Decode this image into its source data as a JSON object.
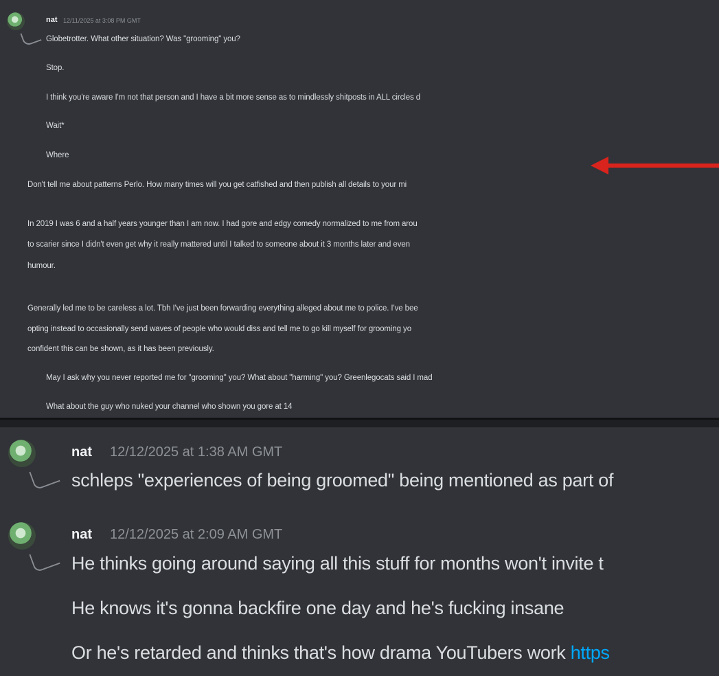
{
  "top_message": {
    "username": "nat",
    "timestamp": "12/11/2025 at 3:08 PM GMT",
    "lines": [
      "Globetrotter. What other situation? Was \"grooming\" you?",
      "Stop.",
      "I think you're aware I'm not that person and I have a bit more sense as to mindlessly shitposts in ALL circles d",
      "Wait*",
      "Where",
      "Don't tell me about patterns Perlo. How many times will you get catfished and then publish all details to your mi",
      "In 2019 I was 6 and a half years younger than I am now. I had gore and edgy comedy normalized to me from arou",
      "to scarier since I didn't even get why it really mattered until I talked to someone about it 3 months later and even",
      "humour.",
      "Generally led me to be careless a lot. Tbh I've just been forwarding everything alleged about me to police. I've bee",
      "opting instead to occasionally send waves of people who would diss and tell me to go kill myself for grooming yo",
      "confident this can be shown, as it has been previously.",
      "May I ask why you never reported me for \"grooming\" you? What about \"harming\" you? Greenlegocats said I mad",
      "What about the guy who nuked your channel who shown you gore at 14"
    ]
  },
  "bottom_messages": [
    {
      "username": "nat",
      "timestamp": "12/12/2025 at 1:38 AM GMT",
      "lines": [
        "schleps \"experiences of being groomed\" being mentioned as part of"
      ]
    },
    {
      "username": "nat",
      "timestamp": "12/12/2025 at 2:09 AM GMT",
      "lines": [
        "He thinks going around saying all this stuff for months won't invite t",
        "He knows it's gonna backfire one day and he's fucking insane",
        "Or he's retarded and thinks that's how drama YouTubers work"
      ],
      "link_text": "https"
    }
  ],
  "colors": {
    "background": "#313338",
    "text": "#dbdee1",
    "timestamp": "#8e9297",
    "link": "#00a8fc",
    "arrow": "#d9231d"
  },
  "icons": [
    "avatar",
    "red-arrow-icon"
  ]
}
